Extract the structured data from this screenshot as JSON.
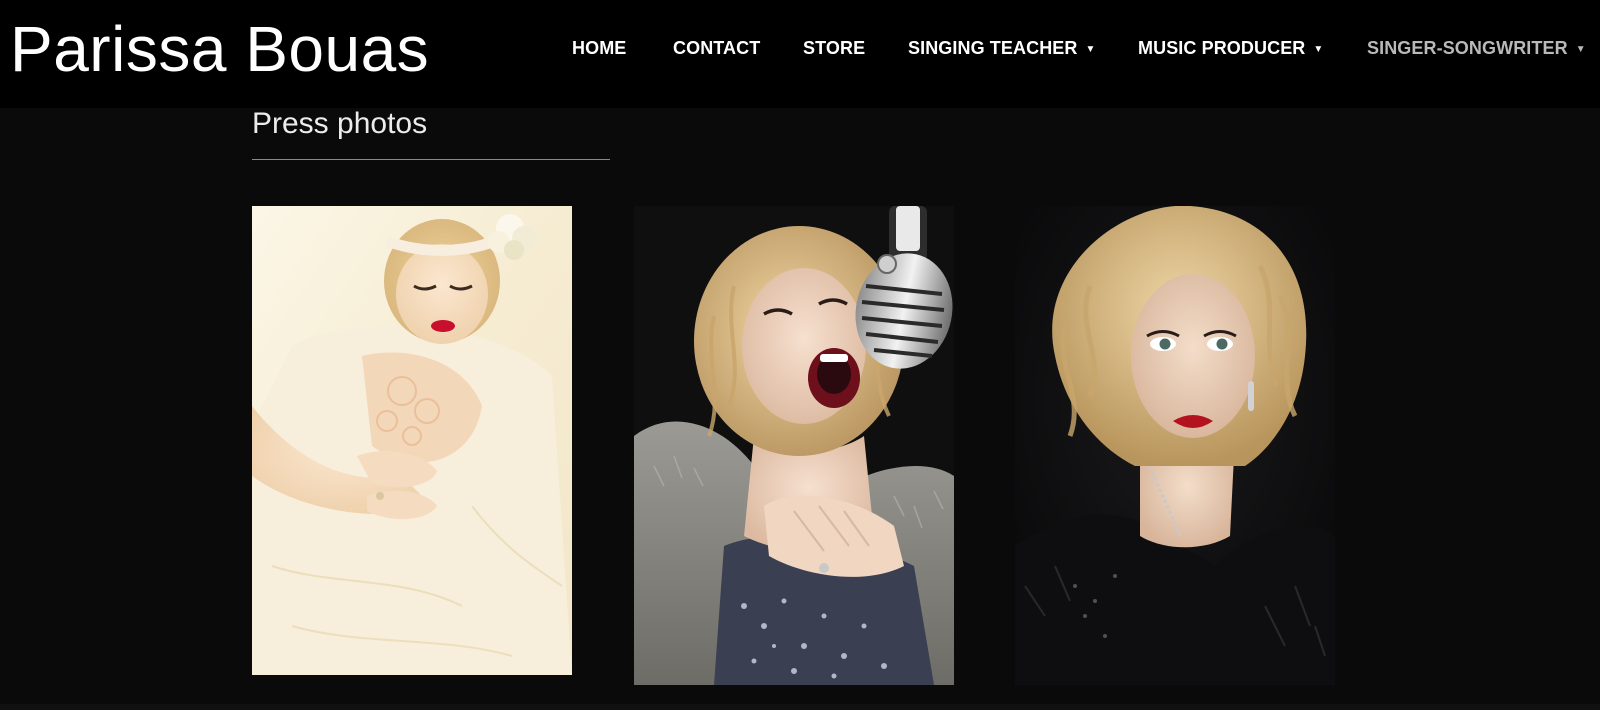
{
  "site": {
    "title": "Parissa Bouas"
  },
  "nav": {
    "items": [
      {
        "label": "HOME",
        "has_dropdown": false
      },
      {
        "label": "CONTACT",
        "has_dropdown": false
      },
      {
        "label": "STORE",
        "has_dropdown": false
      },
      {
        "label": "SINGING TEACHER",
        "has_dropdown": true
      },
      {
        "label": "MUSIC PRODUCER",
        "has_dropdown": true
      },
      {
        "label": "SINGER-SONGWRITER",
        "has_dropdown": true
      }
    ],
    "dropdown_glyph": "▼"
  },
  "main": {
    "heading": "Press photos"
  },
  "photos": [
    {
      "icon": "press-photo-white-dress"
    },
    {
      "icon": "press-photo-microphone"
    },
    {
      "icon": "press-photo-portrait"
    }
  ],
  "colors": {
    "header_bg": "#000000",
    "page_bg": "#0a0a0a",
    "nav_text": "#ffffff",
    "nav_text_dim": "#b9b9b9",
    "heading_text": "#ececec",
    "rule": "#8a8a8a"
  }
}
